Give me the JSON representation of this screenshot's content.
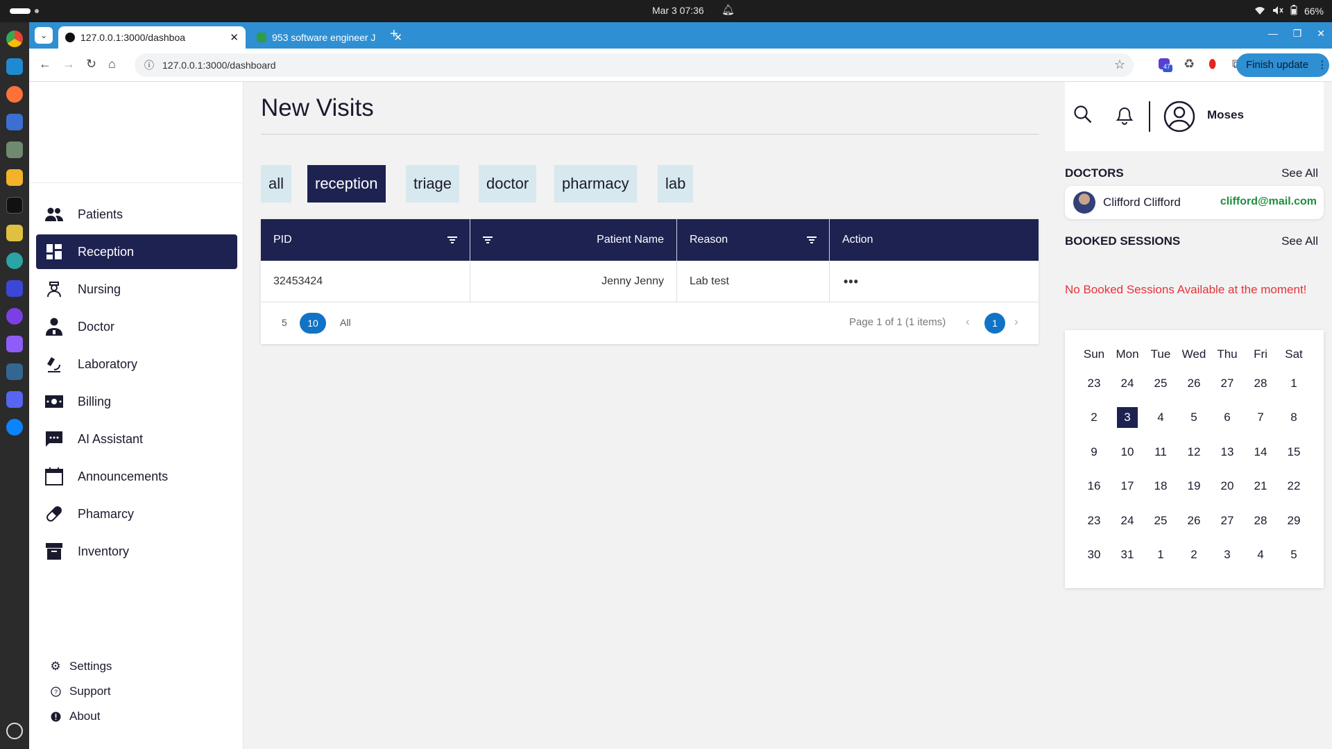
{
  "system_bar": {
    "clock": "Mar 3  07:36",
    "battery": "66%"
  },
  "browser": {
    "tabs": [
      {
        "title": "127.0.0.1:3000/dashboa"
      },
      {
        "title": "953 software engineer J"
      }
    ],
    "url": "127.0.0.1:3000/dashboard",
    "extension_badge": "47",
    "update_label": "Finish update"
  },
  "sidebar": {
    "items": [
      {
        "label": "Patients",
        "icon": "people-icon"
      },
      {
        "label": "Reception",
        "icon": "dashboard-grid-icon"
      },
      {
        "label": "Nursing",
        "icon": "nurse-icon"
      },
      {
        "label": "Doctor",
        "icon": "doctor-icon"
      },
      {
        "label": "Laboratory",
        "icon": "microscope-icon"
      },
      {
        "label": "Billing",
        "icon": "money-icon"
      },
      {
        "label": "AI Assistant",
        "icon": "chat-icon"
      },
      {
        "label": "Announcements",
        "icon": "calendar-icon"
      },
      {
        "label": "Phamarcy",
        "icon": "pill-icon"
      },
      {
        "label": "Inventory",
        "icon": "archive-icon"
      }
    ],
    "footer": [
      {
        "label": "Settings",
        "icon": "gear-icon"
      },
      {
        "label": "Support",
        "icon": "help-icon"
      },
      {
        "label": "About",
        "icon": "info-icon"
      }
    ]
  },
  "main": {
    "title": "New Visits",
    "filters": [
      "all",
      "reception",
      "triage",
      "doctor",
      "pharmacy",
      "lab"
    ],
    "active_filter": "reception",
    "table": {
      "columns": [
        "PID",
        "Patient Name",
        "Reason",
        "Action"
      ],
      "rows": [
        {
          "pid": "32453424",
          "patient_name": "Jenny Jenny",
          "reason": "Lab test",
          "action": "•••"
        }
      ]
    },
    "pager": {
      "sizes": [
        "5",
        "10",
        "All"
      ],
      "selected_size": "10",
      "info": "Page 1 of 1 (1 items)",
      "current_page": "1"
    }
  },
  "right_panel": {
    "user_name": "Moses",
    "doctors_heading": "DOCTORS",
    "doctors_see_all": "See All",
    "doctor": {
      "name": "Clifford Clifford",
      "email": "clifford@mail.com"
    },
    "sessions_heading": "BOOKED SESSIONS",
    "sessions_see_all": "See All",
    "sessions_empty": "No Booked Sessions Available at the moment!",
    "calendar": {
      "weekdays": [
        "Sun",
        "Mon",
        "Tue",
        "Wed",
        "Thu",
        "Fri",
        "Sat"
      ],
      "days": [
        "23",
        "24",
        "25",
        "26",
        "27",
        "28",
        "1",
        "2",
        "3",
        "4",
        "5",
        "6",
        "7",
        "8",
        "9",
        "10",
        "11",
        "12",
        "13",
        "14",
        "15",
        "16",
        "17",
        "18",
        "19",
        "20",
        "21",
        "22",
        "23",
        "24",
        "25",
        "26",
        "27",
        "28",
        "29",
        "30",
        "31",
        "1",
        "2",
        "3",
        "4",
        "5"
      ],
      "today": "3"
    }
  },
  "colors": {
    "accent": "#1e2251",
    "chip_bg": "#d7e8ee",
    "pager_blue": "#1173c6",
    "email_green": "#1e8e3e",
    "warning_red": "#e5323a",
    "browser_blue": "#2f8fd3"
  }
}
